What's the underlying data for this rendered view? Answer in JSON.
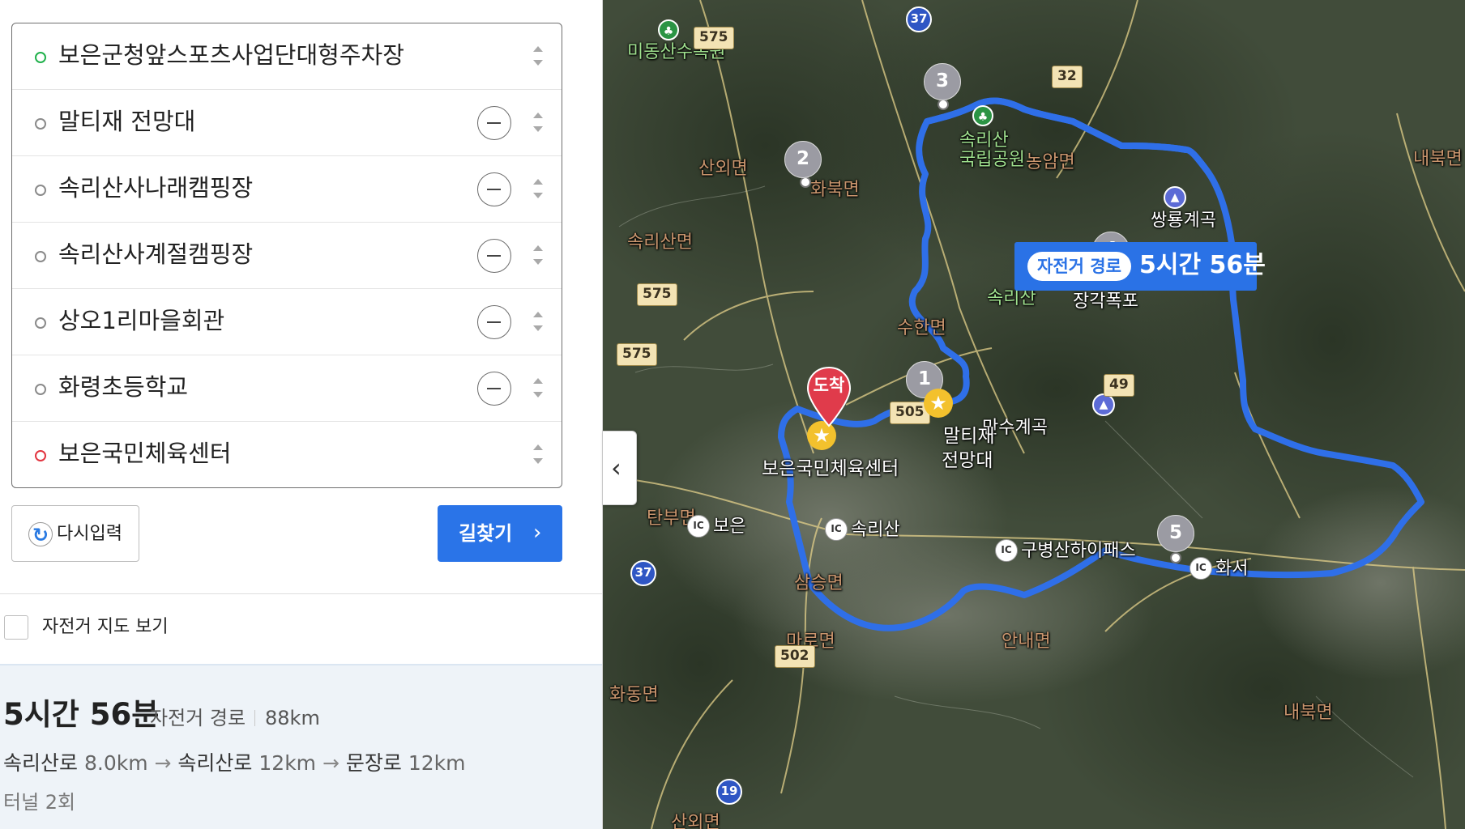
{
  "waypoints": [
    {
      "name": "보은군청앞스포츠사업단대형주차장",
      "role": "start"
    },
    {
      "name": "말티재 전망대"
    },
    {
      "name": "속리산사나래캠핑장"
    },
    {
      "name": "속리산사계절캠핑장"
    },
    {
      "name": "상오1리마을회관"
    },
    {
      "name": "화령초등학교"
    },
    {
      "name": "보은국민체육센터",
      "role": "end"
    }
  ],
  "controls": {
    "reset_label": "다시입력",
    "search_label": "길찾기",
    "bike_map_label": "자전거 지도 보기",
    "bike_map_checked": false
  },
  "summary": {
    "duration": "5시간 56분",
    "route_type": "자전거 경로",
    "distance": "88km",
    "roads": [
      {
        "name": "속리산로",
        "km": "8.0km"
      },
      {
        "name": "속리산로",
        "km": "12km"
      },
      {
        "name": "문장로",
        "km": "12km"
      }
    ],
    "tunnels": "터널 2회"
  },
  "map": {
    "badge": {
      "type": "자전거 경로",
      "time": "5시간 56분"
    },
    "arrive_label": "도착",
    "markers": [
      "1",
      "2",
      "3",
      "4",
      "5"
    ],
    "areas": [
      "산외면",
      "화북면",
      "농암면",
      "내북면",
      "속리산면",
      "수한면",
      "탄부면",
      "삼승면",
      "마로면",
      "안내면",
      "화동면",
      "내북면",
      "산외면"
    ],
    "pois": [
      "미동산수목원",
      "속리산",
      "국립공원",
      "속리산",
      "쌍룡계곡",
      "장각폭포",
      "만수계곡",
      "보은국민체육센터",
      "말티재",
      "전망대"
    ],
    "ic": [
      "보은",
      "속리산",
      "구병산하이패스",
      "화서"
    ],
    "shields": [
      "575",
      "32",
      "575",
      "575",
      "505",
      "49",
      "502"
    ],
    "national": [
      "37",
      "37",
      "19"
    ]
  },
  "colors": {
    "route": "#2f6fe8",
    "accent": "#2a74e8",
    "start": "#21b14c",
    "end": "#e2343f"
  }
}
